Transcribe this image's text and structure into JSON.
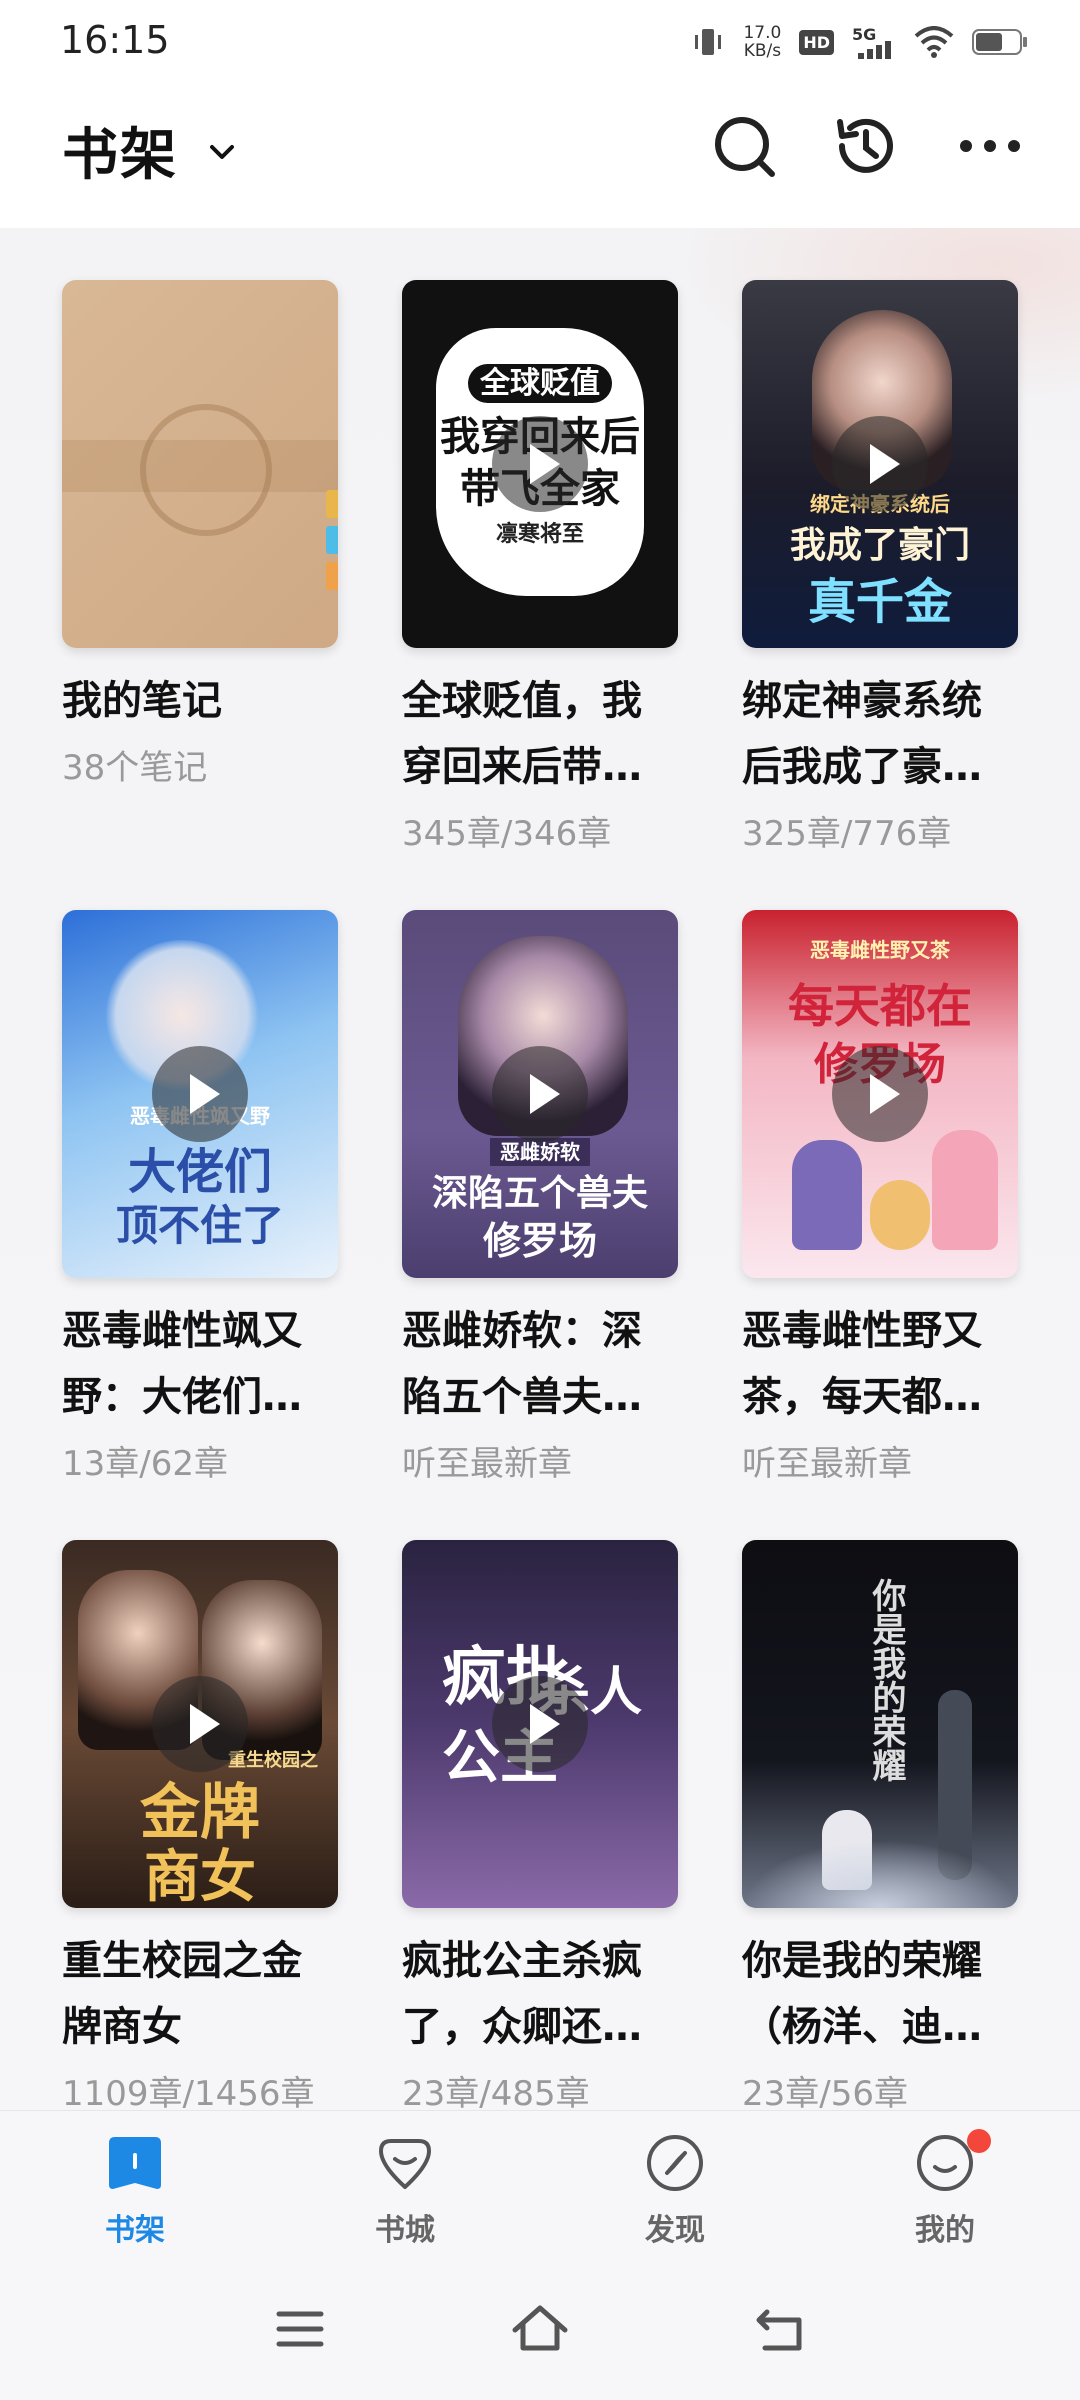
{
  "status": {
    "time": "16:15",
    "net_speed_value": "17.0",
    "net_speed_unit": "KB/s",
    "hd_label": "HD",
    "network": "5G"
  },
  "header": {
    "title": "书架"
  },
  "notes": {
    "title": "我的笔记",
    "count": "38个笔记"
  },
  "books": [
    {
      "title": "全球贬值，我穿回来后带飞全家",
      "progress": "345章/346章",
      "cover_line1": "全球贬值",
      "cover_line2": "我穿回来后",
      "cover_line3": "带飞全家",
      "cover_author": "凛寒将至"
    },
    {
      "title": "绑定神豪系统后我成了豪门真千金",
      "progress": "325章/776章",
      "cover_line1": "绑定神豪系统后",
      "cover_line2": "我成了豪门",
      "cover_line3": "真千金"
    },
    {
      "title": "恶毒雌性飒又野：大佬们顶不住了",
      "progress": "13章/62章",
      "cover_line1": "恶毒雌性飒又野",
      "cover_line2": "大佬们",
      "cover_line3": "顶不住了"
    },
    {
      "title": "恶雌娇软：深陷五个兽夫修罗场",
      "progress": "听至最新章",
      "cover_line1": "恶雌娇软",
      "cover_line2": "深陷五个兽夫",
      "cover_line3": "修罗场"
    },
    {
      "title": "恶毒雌性野又茶，每天都在修罗场",
      "progress": "听至最新章",
      "cover_line1": "恶毒雌性野又茶",
      "cover_line2": "每天都在",
      "cover_line3": "修罗场"
    },
    {
      "title": "重生校园之金牌商女",
      "progress": "1109章/1456章",
      "cover_line1": "重生校园之",
      "cover_line2": "金牌",
      "cover_line3": "商女"
    },
    {
      "title": "疯批公主杀疯了，众卿还在修罗场",
      "progress": "23章/485章",
      "cover_line1": "疯批",
      "cover_line2": "公主",
      "cover_line3": "杀人"
    },
    {
      "title": "你是我的荣耀（杨洋、迪丽热巴主演）",
      "progress": "23章/56章",
      "cover_line1": "你是我的荣耀",
      "cover_line2": "",
      "cover_line3": ""
    }
  ],
  "nav": {
    "shelf": "书架",
    "store": "书城",
    "discover": "发现",
    "mine": "我的",
    "active": "shelf"
  },
  "colors": {
    "accent": "#1e88e5",
    "badge": "#f4473b"
  }
}
